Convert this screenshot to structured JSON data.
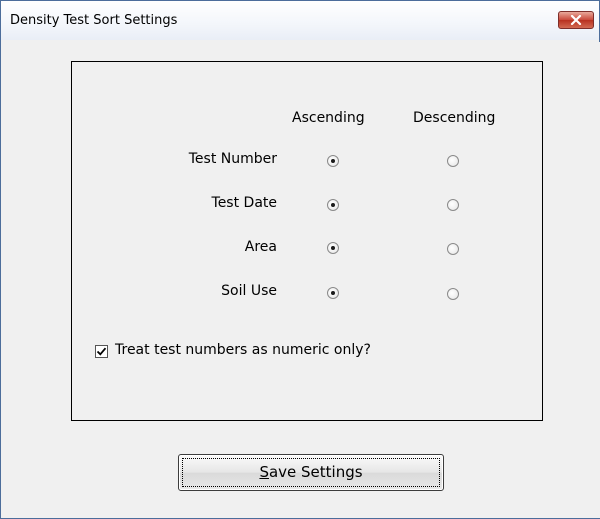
{
  "window": {
    "title": "Density Test Sort Settings",
    "close_icon": "close-icon"
  },
  "sort": {
    "headers": {
      "ascending": "Ascending",
      "descending": "Descending"
    },
    "rows": [
      {
        "label": "Test Number",
        "selected": "ascending"
      },
      {
        "label": "Test Date",
        "selected": "ascending"
      },
      {
        "label": "Area",
        "selected": "ascending"
      },
      {
        "label": "Soil Use",
        "selected": "ascending"
      }
    ]
  },
  "options": {
    "numeric_only_label": "Treat test numbers as numeric only?",
    "numeric_only_checked": true
  },
  "buttons": {
    "save_mnemonic": "S",
    "save_rest": "ave Settings"
  }
}
